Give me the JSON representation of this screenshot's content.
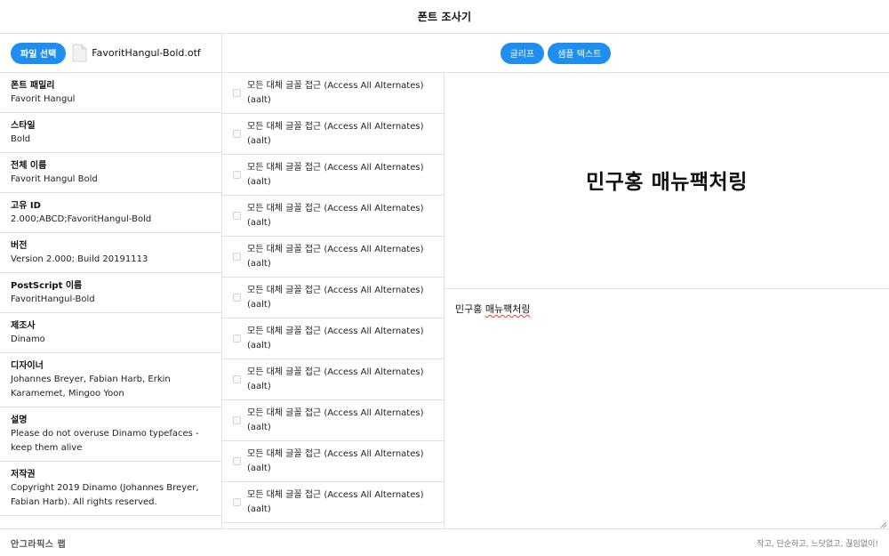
{
  "app": {
    "title": "폰트 조사기"
  },
  "left_toolbar": {
    "file_button_label": "파일 선택",
    "file_icon": "file-icon",
    "file_name": "FavoritHangul-Bold.otf"
  },
  "top_toolbar": {
    "glyphs_button_label": "글리프",
    "sample_text_button_label": "샘플 텍스트"
  },
  "font_info": [
    {
      "label": "폰트 패밀리",
      "value": "Favorit Hangul"
    },
    {
      "label": "스타일",
      "value": "Bold"
    },
    {
      "label": "전체 이름",
      "value": "Favorit Hangul Bold"
    },
    {
      "label": "고유 ID",
      "value": "2.000;ABCD;FavoritHangul-Bold"
    },
    {
      "label": "버전",
      "value": "Version 2.000; Build 20191113"
    },
    {
      "label": "PostScript 이름",
      "value": "FavoritHangul-Bold"
    },
    {
      "label": "제조사",
      "value": "Dinamo"
    },
    {
      "label": "디자이너",
      "value": "Johannes Breyer, Fabian Harb, Erkin Karamemet, Mingoo Yoon"
    },
    {
      "label": "설명",
      "value": "Please do not overuse Dinamo typefaces - keep them alive"
    },
    {
      "label": "저작권",
      "value": "Copyright 2019 Dinamo (Johannes Breyer, Fabian Harb). All rights reserved."
    }
  ],
  "features": [
    {
      "label": "모든 대체 글꼴 접근 (Access All Alternates) (aalt)",
      "checked": false
    },
    {
      "label": "모든 대체 글꼴 접근 (Access All Alternates) (aalt)",
      "checked": false
    },
    {
      "label": "모든 대체 글꼴 접근 (Access All Alternates) (aalt)",
      "checked": false
    },
    {
      "label": "모든 대체 글꼴 접근 (Access All Alternates) (aalt)",
      "checked": false
    },
    {
      "label": "모든 대체 글꼴 접근 (Access All Alternates) (aalt)",
      "checked": false
    },
    {
      "label": "모든 대체 글꼴 접근 (Access All Alternates) (aalt)",
      "checked": false
    },
    {
      "label": "모든 대체 글꼴 접근 (Access All Alternates) (aalt)",
      "checked": false
    },
    {
      "label": "모든 대체 글꼴 접근 (Access All Alternates) (aalt)",
      "checked": false
    },
    {
      "label": "모든 대체 글꼴 접근 (Access All Alternates) (aalt)",
      "checked": false
    },
    {
      "label": "모든 대체 글꼴 접근 (Access All Alternates) (aalt)",
      "checked": false
    },
    {
      "label": "모든 대체 글꼴 접근 (Access All Alternates) (aalt)",
      "checked": false
    }
  ],
  "preview": {
    "text": "민구홍 매뉴팩처링"
  },
  "editor": {
    "word1": "민구홍",
    "word2": "매뉴팩처링"
  },
  "footer": {
    "logo": "안그라픽스 랩",
    "tagline": "작고, 단순하고, 느닷없고, 끊임없이!"
  },
  "colors": {
    "accent": "#1f8ef1",
    "border": "#e1e1e1",
    "spellcheck": "#e53935"
  }
}
